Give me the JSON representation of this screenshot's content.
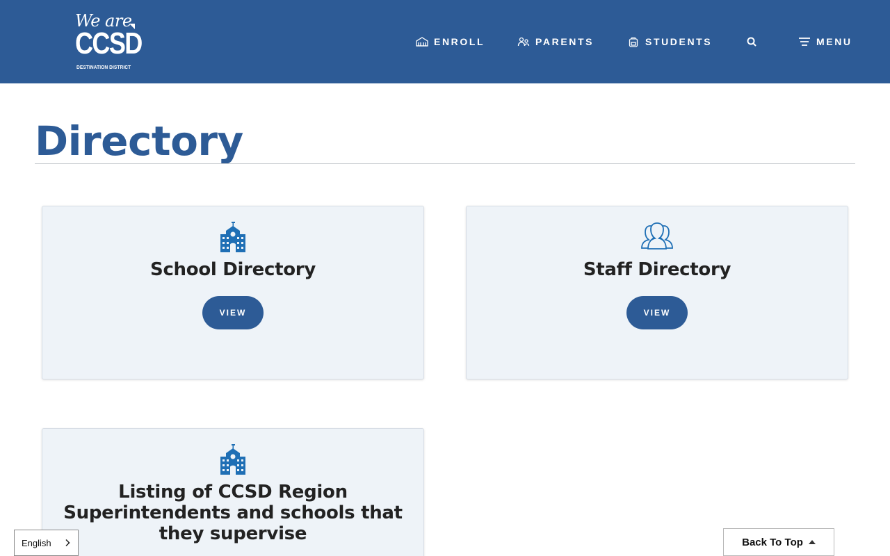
{
  "header": {
    "logo": {
      "line1": "We are",
      "line2": "CCSD",
      "tagline": "DESTINATION DISTRICT"
    },
    "nav": [
      {
        "label": "ENROLL",
        "icon": "school-building-icon"
      },
      {
        "label": "PARENTS",
        "icon": "parents-icon"
      },
      {
        "label": "STUDENTS",
        "icon": "backpack-icon"
      },
      {
        "label": "",
        "icon": "search-icon"
      },
      {
        "label": "MENU",
        "icon": "hamburger-menu-icon"
      }
    ]
  },
  "main": {
    "title": "Directory",
    "cards": [
      {
        "title": "School Directory",
        "button": "VIEW",
        "icon": "school-icon"
      },
      {
        "title": "Staff Directory",
        "button": "VIEW",
        "icon": "people-group-icon"
      },
      {
        "title": "Listing of CCSD Region Superintendents and schools that they supervise",
        "icon": "school-icon"
      }
    ]
  },
  "language": {
    "selected": "English"
  },
  "back_to_top": {
    "label": "Back To Top"
  },
  "colors": {
    "brand_blue": "#2d5b96",
    "icon_blue": "#1f6fb5",
    "card_bg": "#eef3f8"
  }
}
